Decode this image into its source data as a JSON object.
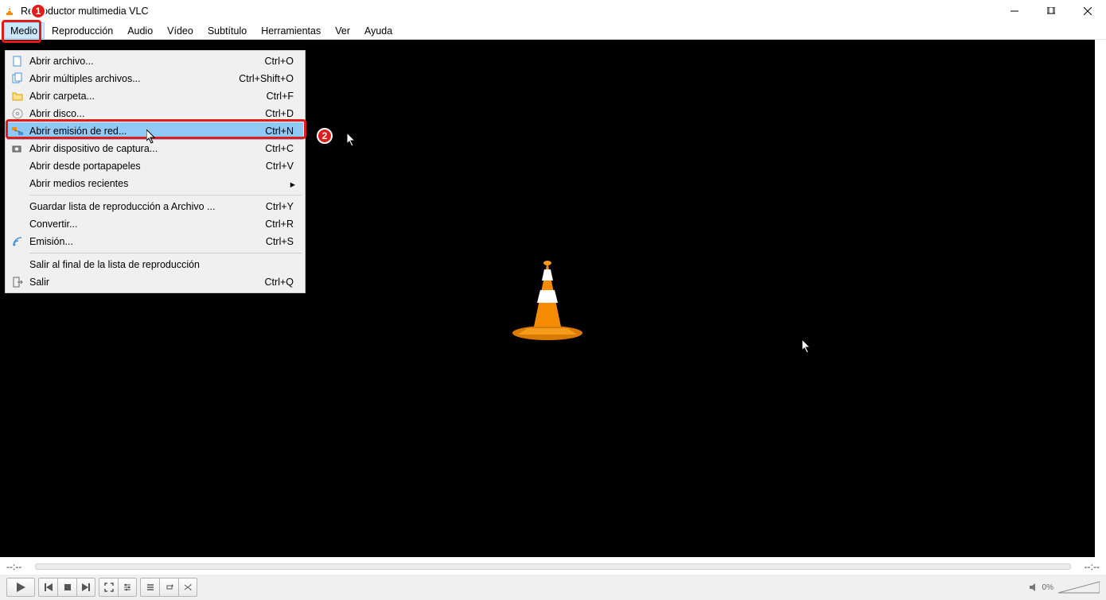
{
  "title": "Reproductor multimedia VLC",
  "menubar": [
    "Medio",
    "Reproducción",
    "Audio",
    "Vídeo",
    "Subtítulo",
    "Herramientas",
    "Ver",
    "Ayuda"
  ],
  "dropdown": {
    "items": [
      {
        "label": "Abrir archivo...",
        "shortcut": "Ctrl+O",
        "icon": "file"
      },
      {
        "label": "Abrir múltiples archivos...",
        "shortcut": "Ctrl+Shift+O",
        "icon": "files"
      },
      {
        "label": "Abrir carpeta...",
        "shortcut": "Ctrl+F",
        "icon": "folder"
      },
      {
        "label": "Abrir disco...",
        "shortcut": "Ctrl+D",
        "icon": "disc"
      },
      {
        "label": "Abrir emisión de red...",
        "shortcut": "Ctrl+N",
        "icon": "net",
        "hover": true
      },
      {
        "label": "Abrir dispositivo de captura...",
        "shortcut": "Ctrl+C",
        "icon": "cap"
      },
      {
        "label": "Abrir desde portapapeles",
        "shortcut": "Ctrl+V"
      },
      {
        "label": "Abrir medios recientes",
        "submenu": true
      },
      {
        "sep": true
      },
      {
        "label": "Guardar lista de reproducción a Archivo ...",
        "shortcut": "Ctrl+Y"
      },
      {
        "label": "Convertir...",
        "shortcut": "Ctrl+R"
      },
      {
        "label": "Emisión...",
        "shortcut": "Ctrl+S",
        "icon": "stream"
      },
      {
        "sep": true
      },
      {
        "label": "Salir al final de la lista de reproducción"
      },
      {
        "label": "Salir",
        "shortcut": "Ctrl+Q",
        "icon": "quit"
      }
    ]
  },
  "time_left": "--:--",
  "time_right": "--:--",
  "volume_pct": "0%",
  "annotations": {
    "1": "1",
    "2": "2"
  }
}
